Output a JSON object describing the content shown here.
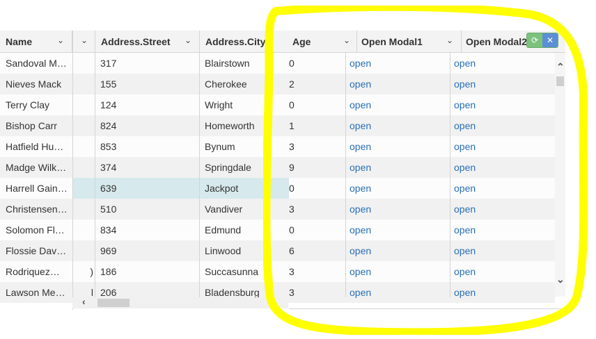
{
  "columns": {
    "name": "Name",
    "street": "Address.Street",
    "city": "Address.City",
    "age": "Age",
    "modal1": "Open Modal1",
    "modal2": "Open Modal2"
  },
  "rows": [
    {
      "name": "Sandoval M…",
      "street": "317",
      "city": "Blairstown",
      "age_frag": "0",
      "m1": "open",
      "m2": "open"
    },
    {
      "name": "Nieves Mack",
      "street": "155",
      "city": "Cherokee",
      "age_frag": "2",
      "m1": "open",
      "m2": "open"
    },
    {
      "name": "Terry Clay",
      "street": "124",
      "city": "Wright",
      "age_frag": "0",
      "m1": "open",
      "m2": "open"
    },
    {
      "name": "Bishop Carr",
      "street": "824",
      "city": "Homeworth",
      "age_frag": "1",
      "m1": "open",
      "m2": "open"
    },
    {
      "name": "Hatfield Hu…",
      "street": "853",
      "city": "Bynum",
      "age_frag": "3",
      "m1": "open",
      "m2": "open"
    },
    {
      "name": "Madge Wilk…",
      "street": "374",
      "city": "Springdale",
      "age_frag": "9",
      "m1": "open",
      "m2": "open"
    },
    {
      "name": "Harrell Gain…",
      "street": "639",
      "city": "Jackpot",
      "age_frag": "0",
      "m1": "open",
      "m2": "open",
      "selected": true
    },
    {
      "name": "Christensen…",
      "street": "510",
      "city": "Vandiver",
      "age_frag": "3",
      "m1": "open",
      "m2": "open"
    },
    {
      "name": "Solomon Fl…",
      "street": "834",
      "city": "Edmund",
      "age_frag": "0",
      "m1": "open",
      "m2": "open"
    },
    {
      "name": "Flossie Dav…",
      "street": "969",
      "city": "Linwood",
      "age_frag": "6",
      "m1": "open",
      "m2": "open"
    },
    {
      "name": "Rodriquez…",
      "street": "186",
      "city": "Succasunna",
      "age_frag": "3",
      "m1": "open",
      "m2": "open",
      "frag": ")"
    },
    {
      "name": "Lawson Me…",
      "street": "206",
      "city": "Bladensburg",
      "age_frag": "3",
      "m1": "open",
      "m2": "open",
      "frag": "l"
    }
  ],
  "icons": {
    "chevron": "chevron-down-icon",
    "refresh": "refresh-icon",
    "expand": "expand-icon",
    "scroll_up": "chevron-up-icon",
    "scroll_down": "chevron-down-icon",
    "scroll_left": "chevron-left-icon",
    "scroll_right": "chevron-right-icon"
  },
  "colors": {
    "link": "#2a6fb5",
    "selected_row": "#d6e9ec",
    "highlight_annotation": "#ffff00"
  }
}
